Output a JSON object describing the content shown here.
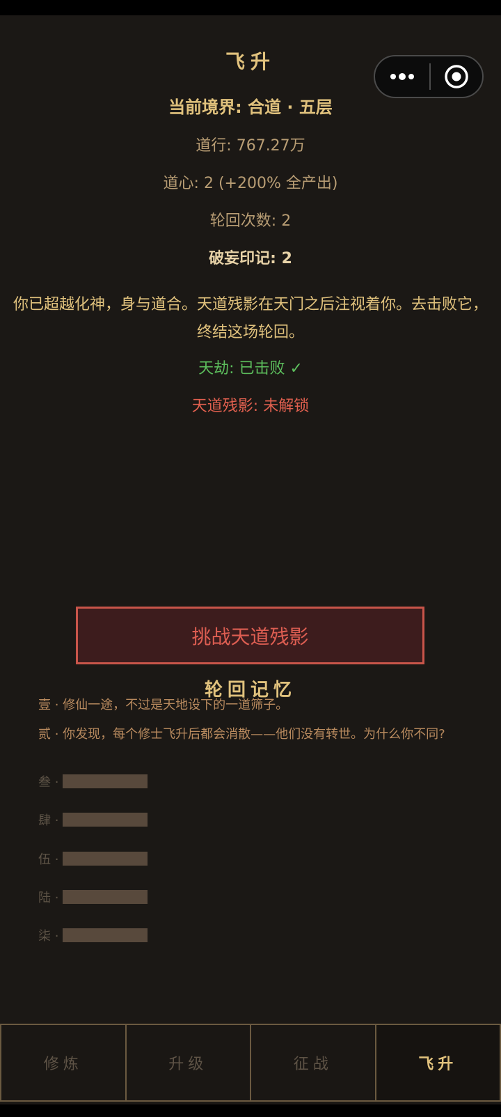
{
  "header": {
    "title": "飞升",
    "realm": "当前境界: 合道 · 五层"
  },
  "capsule": {
    "more_icon": "more-dots-icon",
    "close_icon": "target-close-icon"
  },
  "stats": {
    "daoxing": "道行: 767.27万",
    "daoxin": "道心: 2 (+200% 全产出)",
    "lunhui": "轮回次数: 2",
    "powang": "破妄印记: 2"
  },
  "description": "你已超越化神，身与道合。天道残影在天门之后注视着你。去击败它，终结这场轮回。",
  "status": {
    "tianjie": "天劫: 已击败 ✓",
    "tiandao": "天道残影: 未解锁"
  },
  "challenge_button": "挑战天道残影",
  "memory": {
    "title": "轮回记忆",
    "unlocked": [
      "壹 · 修仙一途，不过是天地设下的一道筛子。",
      "贰 · 你发现，每个修士飞升后都会消散——他们没有转世。为什么你不同?"
    ],
    "locked": [
      "叁 ·",
      "肆 ·",
      "伍 ·",
      "陆 ·",
      "柒 ·"
    ]
  },
  "tabs": [
    {
      "label": "修炼",
      "active": false
    },
    {
      "label": "升级",
      "active": false
    },
    {
      "label": "征战",
      "active": false
    },
    {
      "label": "飞升",
      "active": true
    }
  ],
  "colors": {
    "background": "#1b1815",
    "gold": "#e1c27d",
    "green": "#5cbd5c",
    "red": "#e2604f"
  }
}
